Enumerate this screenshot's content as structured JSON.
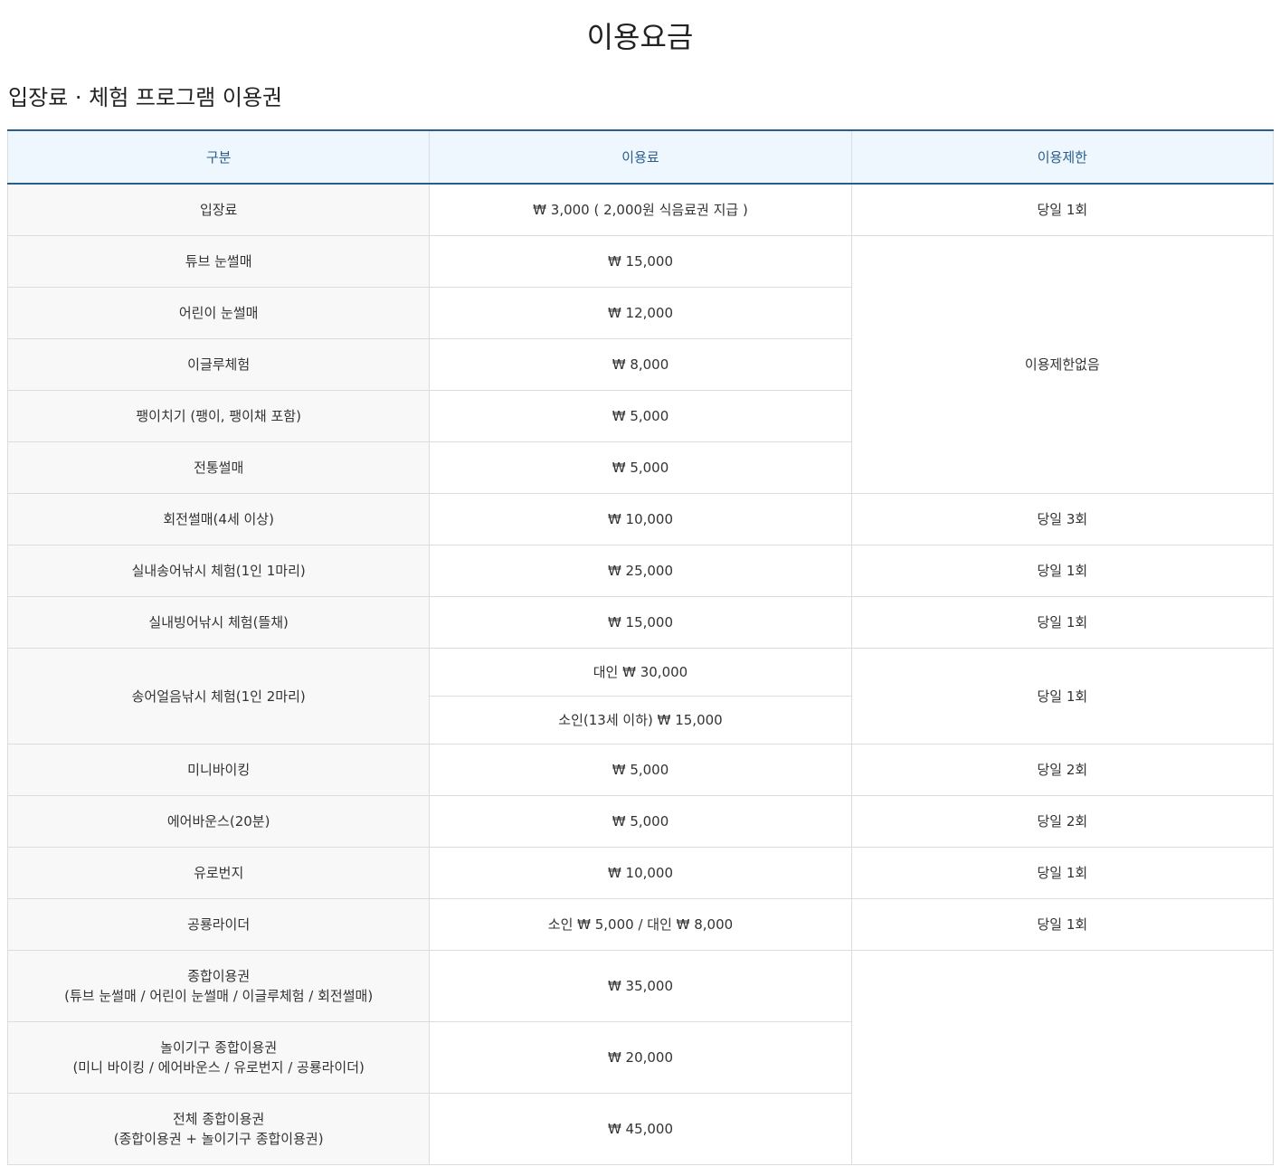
{
  "page": {
    "title": "이용요금"
  },
  "section": {
    "title": "입장료 · 체험 프로그램 이용권"
  },
  "table": {
    "headers": [
      "구분",
      "이용료",
      "이용제한"
    ],
    "rows": [
      {
        "category": "입장료",
        "price": "₩ 3,000 ( 2,000원 식음료권 지급 )",
        "limit": "당일 1회"
      },
      {
        "category": "튜브 눈썰매",
        "price": "₩ 15,000",
        "limit": "이용제한없음"
      },
      {
        "category": "어린이 눈썰매",
        "price": "₩ 12,000"
      },
      {
        "category": "이글루체험",
        "price": "₩ 8,000"
      },
      {
        "category": "팽이치기 (팽이, 팽이채 포함)",
        "price": "₩ 5,000"
      },
      {
        "category": "전통썰매",
        "price": "₩ 5,000"
      },
      {
        "category": "회전썰매(4세 이상)",
        "price": "₩ 10,000",
        "limit": "당일 3회"
      },
      {
        "category": "실내송어낚시 체험(1인 1마리)",
        "price": "₩ 25,000",
        "limit": "당일 1회"
      },
      {
        "category": "실내빙어낚시 체험(뜰채)",
        "price": "₩ 15,000",
        "limit": "당일 1회"
      },
      {
        "category": "송어얼음낚시 체험(1인 2마리)",
        "price": "대인 ₩ 30,000",
        "limit": "당일 1회"
      },
      {
        "price": "소인(13세 이하) ₩ 15,000"
      },
      {
        "category": "미니바이킹",
        "price": "₩ 5,000",
        "limit": "당일 2회"
      },
      {
        "category": "에어바운스(20분)",
        "price": "₩ 5,000",
        "limit": "당일 2회"
      },
      {
        "category": "유로번지",
        "price": "₩ 10,000",
        "limit": "당일 1회"
      },
      {
        "category": "공룡라이더",
        "price": "소인 ₩ 5,000 / 대인 ₩ 8,000",
        "limit": "당일 1회"
      },
      {
        "category": "종합이용권",
        "category_sub": "(튜브 눈썰매 / 어린이 눈썰매 / 이글루체험 / 회전썰매)",
        "price": "₩ 35,000",
        "limit": ""
      },
      {
        "category": "놀이기구 종합이용권",
        "category_sub": "(미니 바이킹 / 에어바운스 / 유로번지 / 공룡라이더)",
        "price": "₩ 20,000"
      },
      {
        "category": "전체 종합이용권",
        "category_sub": "(종합이용권 + 놀이기구 종합이용권)",
        "price": "₩ 45,000"
      }
    ]
  }
}
